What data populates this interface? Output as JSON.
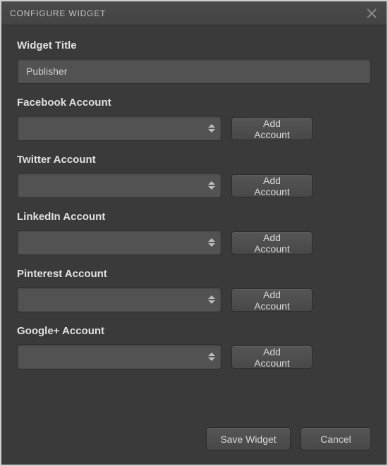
{
  "dialog": {
    "title": "CONFIGURE WIDGET"
  },
  "form": {
    "widget_title_label": "Widget Title",
    "widget_title_value": "Publisher"
  },
  "accounts": {
    "facebook": {
      "label": "Facebook Account",
      "selected": "",
      "add_button": "Add Account"
    },
    "twitter": {
      "label": "Twitter Account",
      "selected": "",
      "add_button": "Add Account"
    },
    "linkedin": {
      "label": "LinkedIn Account",
      "selected": "",
      "add_button": "Add Account"
    },
    "pinterest": {
      "label": "Pinterest Account",
      "selected": "",
      "add_button": "Add Account"
    },
    "googleplus": {
      "label": "Google+ Account",
      "selected": "",
      "add_button": "Add Account"
    }
  },
  "footer": {
    "save": "Save Widget",
    "cancel": "Cancel"
  }
}
